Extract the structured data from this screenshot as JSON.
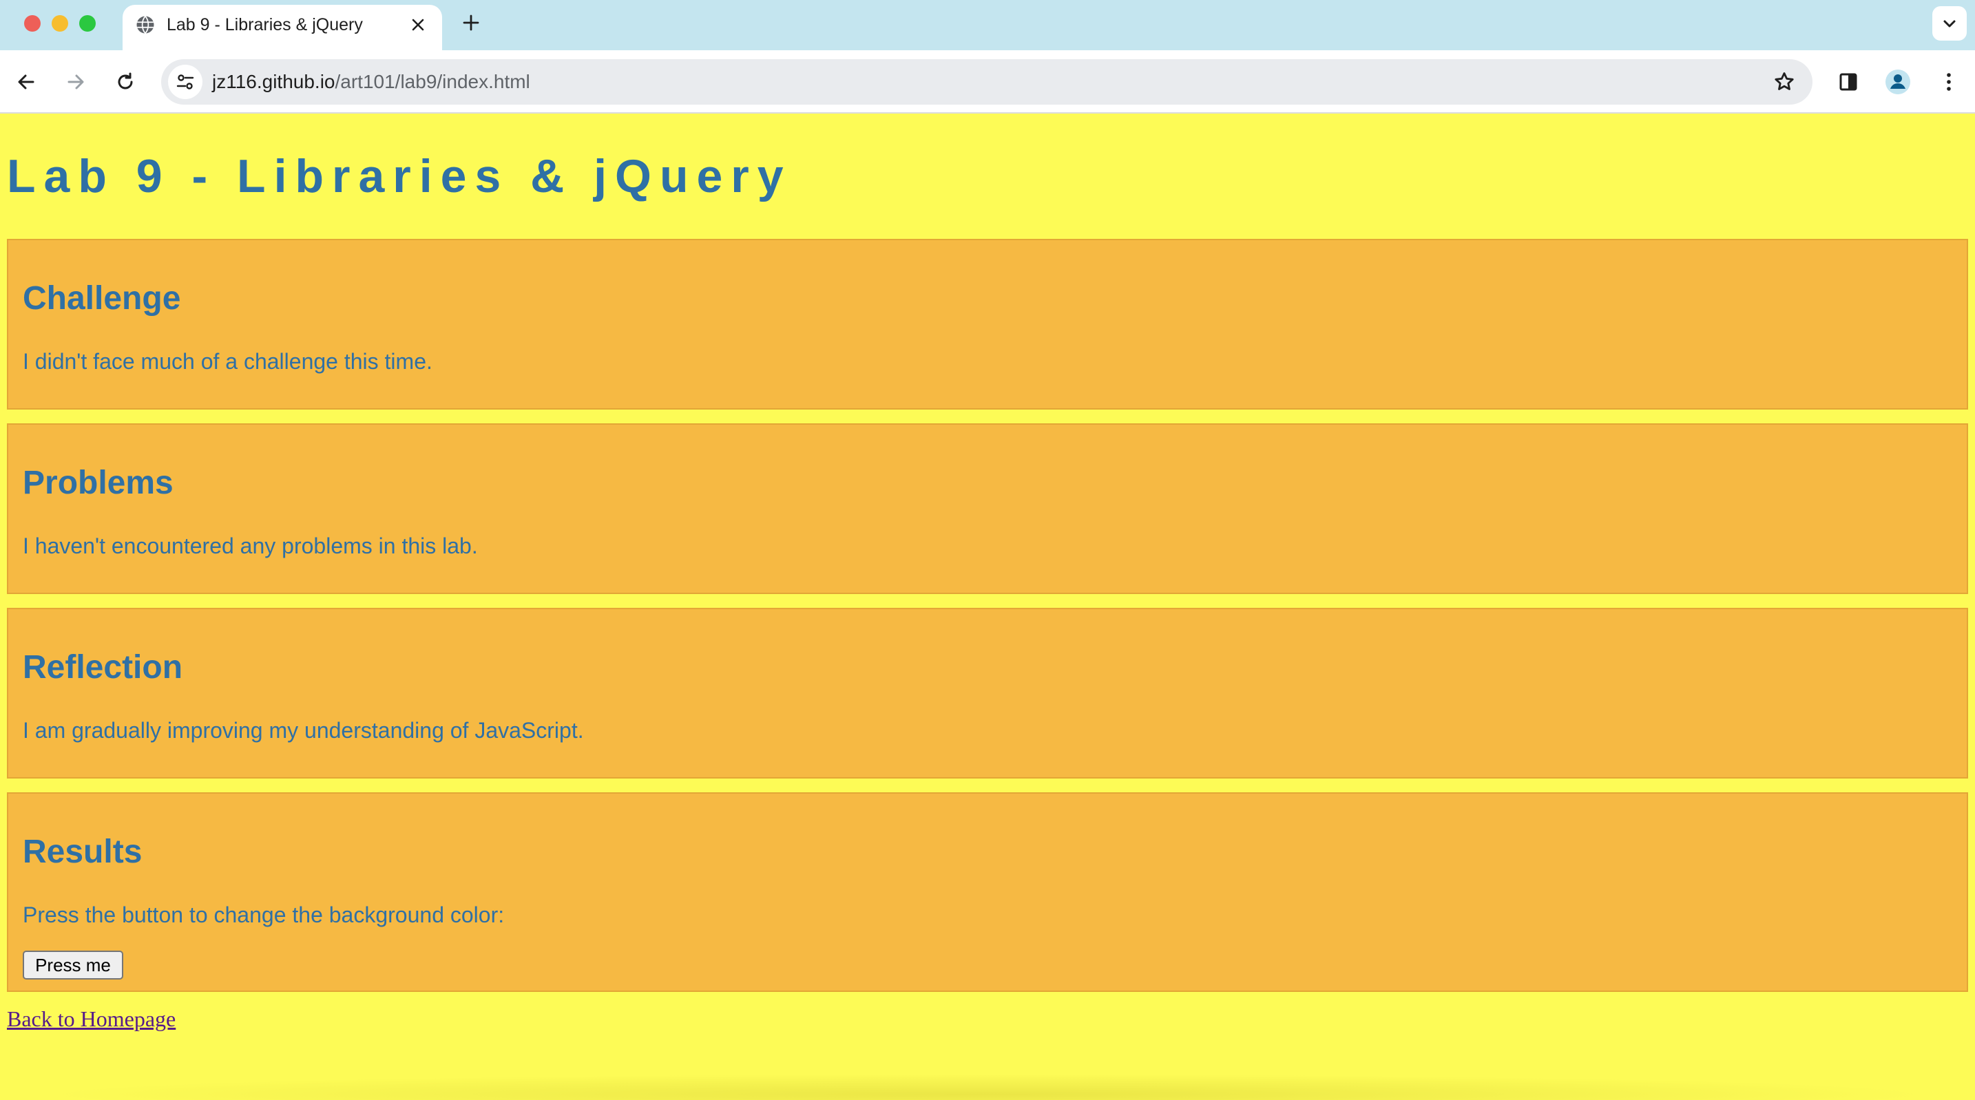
{
  "browser": {
    "tab_title": "Lab 9 - Libraries & jQuery",
    "url_host": "jz116.github.io",
    "url_path": "/art101/lab9/index.html"
  },
  "page": {
    "title": "Lab 9 - Libraries & jQuery",
    "sections": [
      {
        "heading": "Challenge",
        "text": "I didn't face much of a challenge this time."
      },
      {
        "heading": "Problems",
        "text": "I haven't encountered any problems in this lab."
      },
      {
        "heading": "Reflection",
        "text": "I am gradually improving my understanding of JavaScript."
      },
      {
        "heading": "Results",
        "text": "Press the button to change the background color:",
        "button_label": "Press me"
      }
    ],
    "back_link": "Back to Homepage"
  },
  "colors": {
    "page_background": "#fdfb56",
    "section_background": "#f6b943",
    "text_blue": "#2f70a5",
    "link_visited": "#551a8b"
  }
}
